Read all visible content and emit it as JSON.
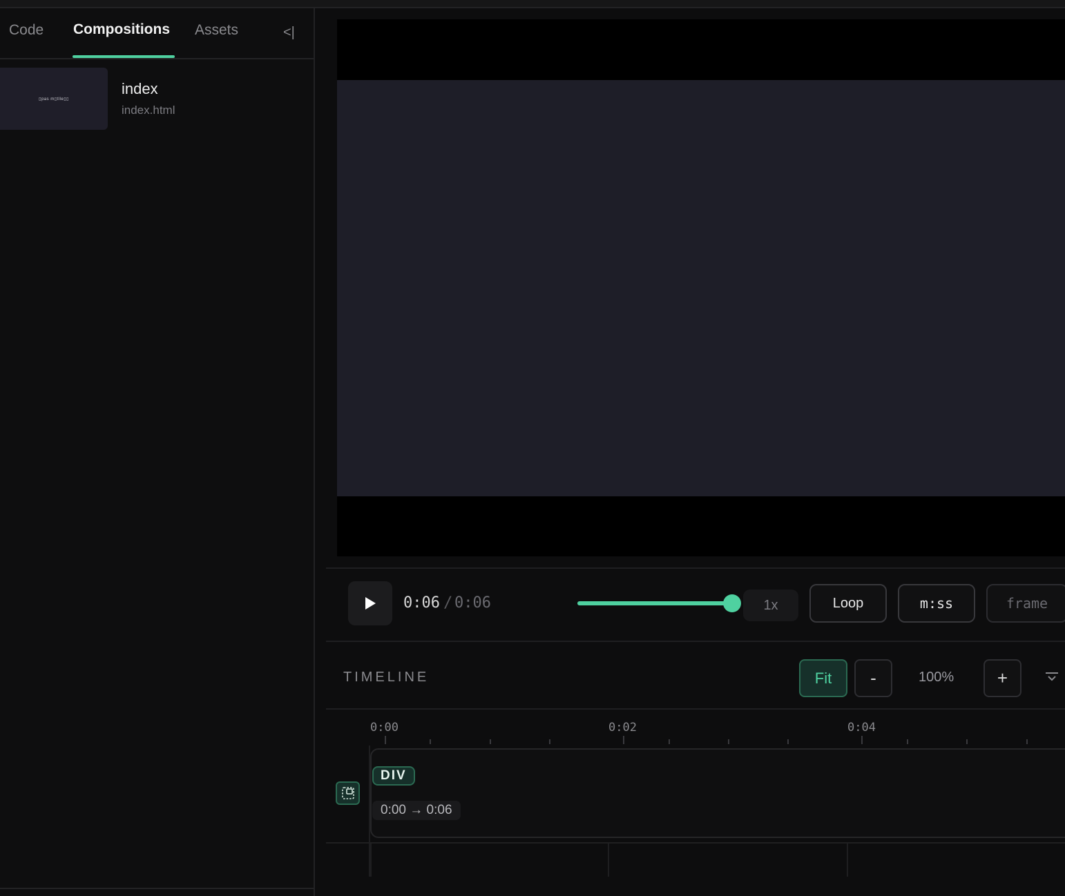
{
  "sidebar": {
    "tabs": [
      {
        "label": "Code"
      },
      {
        "label": "Compositions"
      },
      {
        "label": "Assets"
      }
    ],
    "collapse_label": "<|",
    "compositions": [
      {
        "name": "index",
        "file": "index.html",
        "thumb_text": "▯pas m▯tlle▯▯"
      }
    ]
  },
  "player": {
    "current_time": "0:06",
    "separator": "/",
    "total_time": "0:06",
    "progress": 1.0,
    "speed": "1x",
    "loop_label": "Loop",
    "format_label": "m:ss",
    "frame_label": "frame"
  },
  "timeline": {
    "title": "TIMELINE",
    "fit_label": "Fit",
    "zoom_out_label": "-",
    "zoom_level": "100%",
    "zoom_in_label": "+",
    "ruler": [
      "0:00",
      "0:02",
      "0:04"
    ],
    "tracks": [
      {
        "tag": "DIV",
        "range": "0:00 → 0:06"
      }
    ]
  },
  "colors": {
    "accent": "#4fd1a0",
    "background": "#0d0d0e",
    "stage": "#1e1e28"
  }
}
